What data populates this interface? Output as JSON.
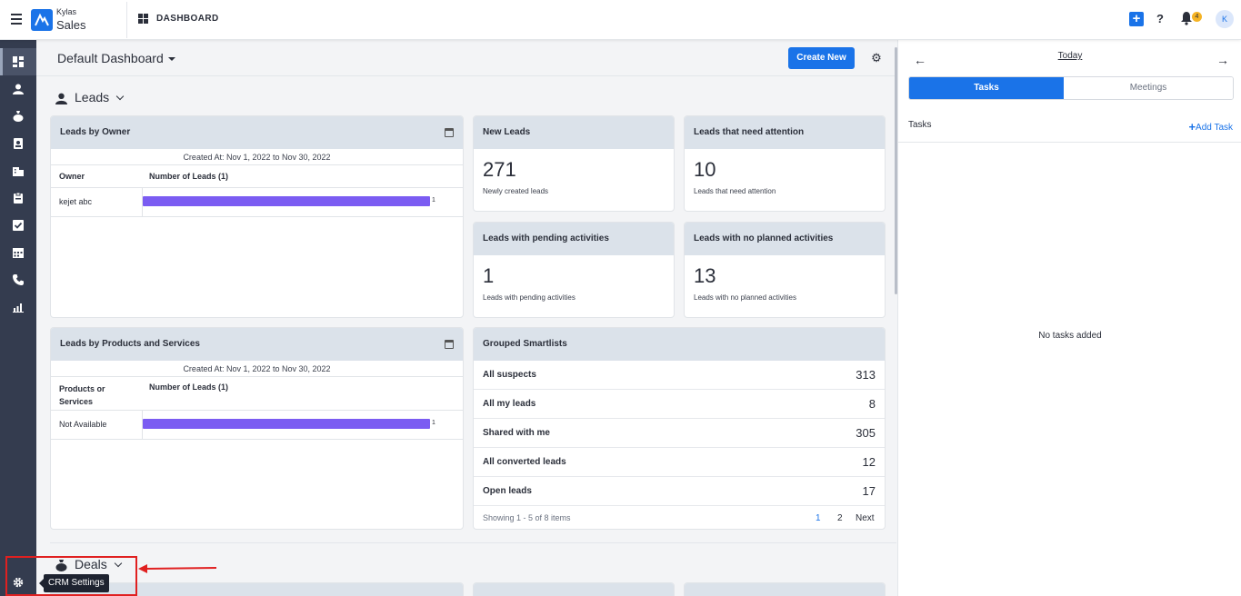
{
  "topbar": {
    "brand": "Kylas",
    "app_name": "Sales",
    "page_title": "DASHBOARD",
    "help_label": "?",
    "notification_count": "4",
    "avatar_initial": "K"
  },
  "leftnav": {
    "items": [
      {
        "icon": "dashboard-icon",
        "glyph": "▦",
        "active": true
      },
      {
        "icon": "leads-icon",
        "glyph": "👤",
        "active": false
      },
      {
        "icon": "deals-icon",
        "glyph": "💰",
        "active": false
      },
      {
        "icon": "contacts-icon",
        "glyph": "▣",
        "active": false
      },
      {
        "icon": "companies-icon",
        "glyph": "▥",
        "active": false
      },
      {
        "icon": "products-icon",
        "glyph": "▤",
        "active": false
      },
      {
        "icon": "tasks-icon",
        "glyph": "☑",
        "active": false
      },
      {
        "icon": "meetings-icon",
        "glyph": "▦",
        "active": false
      },
      {
        "icon": "calls-icon",
        "glyph": "☎",
        "active": false
      },
      {
        "icon": "reports-icon",
        "glyph": "▥",
        "active": false
      }
    ],
    "settings_tooltip": "CRM Settings"
  },
  "dashboard": {
    "selected": "Default Dashboard",
    "create_button": "Create New"
  },
  "sections": {
    "leads": "Leads",
    "deals": "Deals"
  },
  "leads_by_owner": {
    "title": "Leads by Owner",
    "created": "Created At: Nov 1, 2022 to Nov 30, 2022",
    "col1": "Owner",
    "col2": "Number of Leads (1)",
    "rows": [
      {
        "name": "kejet abc",
        "value": "1",
        "fraction": 1.0
      }
    ]
  },
  "leads_by_products": {
    "title": "Leads by Products and Services",
    "created": "Created At: Nov 1, 2022 to Nov 30, 2022",
    "col1": "Products or Services",
    "col2": "Number of Leads (1)",
    "rows": [
      {
        "name": "Not Available",
        "value": "1",
        "fraction": 1.0
      }
    ]
  },
  "metrics": {
    "new_leads": {
      "title": "New Leads",
      "value": "271",
      "sub": "Newly created leads"
    },
    "attention": {
      "title": "Leads that need attention",
      "value": "10",
      "sub": "Leads that need attention"
    },
    "pending": {
      "title": "Leads with pending activities",
      "value": "1",
      "sub": "Leads with pending activities"
    },
    "no_planned": {
      "title": "Leads with no planned activities",
      "value": "13",
      "sub": "Leads with no planned activities"
    }
  },
  "smartlists": {
    "title": "Grouped Smartlists",
    "rows": [
      {
        "name": "All suspects",
        "count": "313"
      },
      {
        "name": "All my leads",
        "count": "8"
      },
      {
        "name": "Shared with me",
        "count": "305"
      },
      {
        "name": "All converted leads",
        "count": "12"
      },
      {
        "name": "Open leads",
        "count": "17"
      }
    ],
    "showing": "Showing 1 - 5 of 8 items",
    "page1": "1",
    "page2": "2",
    "next": "Next"
  },
  "right_panel": {
    "date_label": "Today",
    "tabs": [
      "Tasks",
      "Meetings"
    ],
    "tasks_label": "Tasks",
    "add_task": "Add Task",
    "empty": "No tasks added"
  },
  "colors": {
    "primary": "#1a73e8",
    "bar": "#7b5cf2",
    "nav_bg": "#343c4f",
    "card_head": "#dbe2ea",
    "annotation": "#e02020"
  }
}
